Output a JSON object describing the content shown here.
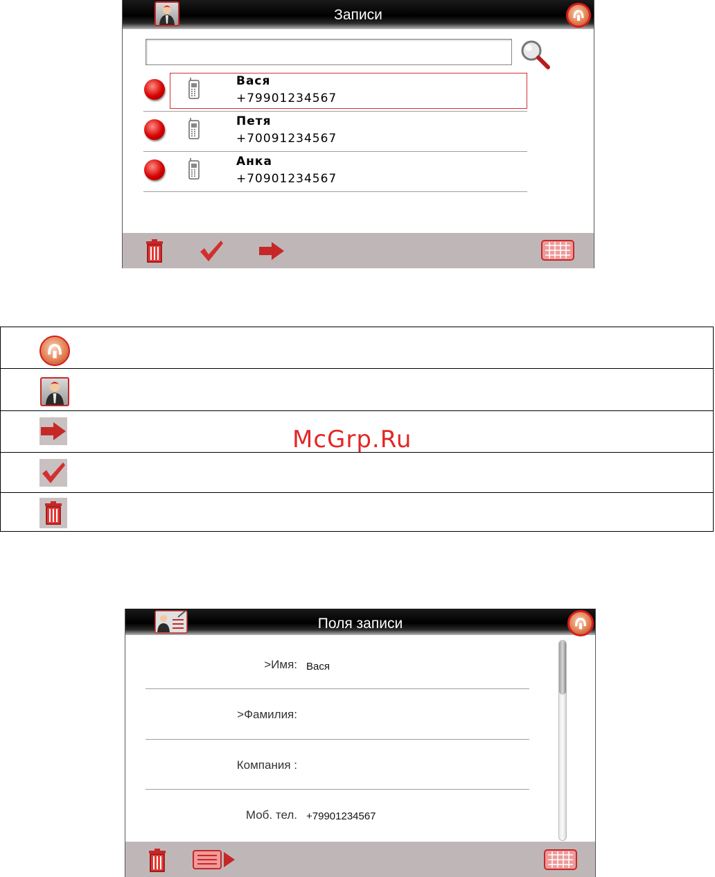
{
  "screen1": {
    "title": "Записи",
    "entries": [
      {
        "name": "Вася",
        "number": "+79901234567"
      },
      {
        "name": "Петя",
        "number": "+70091234567"
      },
      {
        "name": "Анка",
        "number": "+70901234567"
      }
    ],
    "toolbar": [
      "trash-icon",
      "check-icon",
      "arrow-right-icon",
      "keyboard-icon"
    ]
  },
  "legend": {
    "rows": [
      "home-icon",
      "contact-avatar-icon",
      "arrow-right-icon",
      "check-icon",
      "trash-icon"
    ]
  },
  "watermark": "McGrp.Ru",
  "screen2": {
    "title": "Поля записи",
    "fields": [
      {
        "label": ">Имя:",
        "value": "Вася"
      },
      {
        "label": ">Фамилия:",
        "value": ""
      },
      {
        "label": "Компания :",
        "value": ""
      },
      {
        "label": "Моб. тел.",
        "value": "+79901234567"
      }
    ],
    "toolbar": [
      "trash-icon",
      "list-forward-icon",
      "keyboard-icon"
    ]
  },
  "colors": {
    "accent": "#d61c1c",
    "toolbar": "#bfb7b7",
    "titlebar": "#000000"
  }
}
